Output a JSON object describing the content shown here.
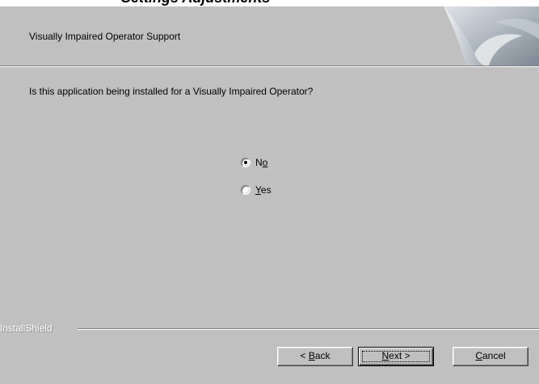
{
  "page_heading_fragment": "Settings Adjustments",
  "header": {
    "title": "Visually Impaired Operator Support",
    "graphic": "curled-page-graphic"
  },
  "question": "Is this application being installed for a Visually Impaired Operator?",
  "options": [
    {
      "pre": "N",
      "mnemonic": "o",
      "post": "",
      "selected": true
    },
    {
      "pre": "",
      "mnemonic": "Y",
      "post": "es",
      "selected": false
    }
  ],
  "branding": "InstallShield",
  "buttons": {
    "back": {
      "pre": "< ",
      "mnemonic": "B",
      "post": "ack"
    },
    "next": {
      "pre": "",
      "mnemonic": "N",
      "post": "ext >"
    },
    "cancel": {
      "pre": "",
      "mnemonic": "C",
      "post": "ancel"
    }
  },
  "colors": {
    "dialog_bg": "#c0c0c0",
    "shadow": "#808080",
    "highlight": "#ffffff"
  }
}
